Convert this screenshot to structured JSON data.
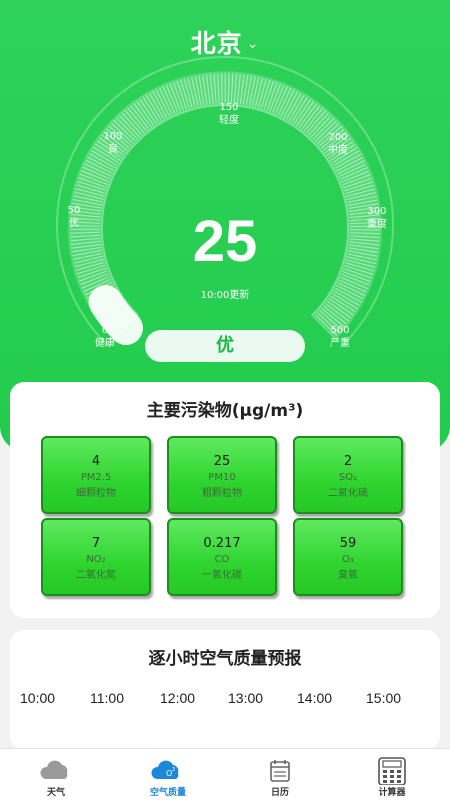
{
  "header": {
    "city": "北京",
    "city_dropdown_icon": "chevron-down-icon"
  },
  "gauge": {
    "value": "25",
    "update_time": "10:00更新",
    "level": "优",
    "ticks": [
      {
        "value": "0",
        "label": "健康"
      },
      {
        "value": "50",
        "label": "优"
      },
      {
        "value": "100",
        "label": "良"
      },
      {
        "value": "150",
        "label": "轻度"
      },
      {
        "value": "200",
        "label": "中度"
      },
      {
        "value": "300",
        "label": "重度"
      },
      {
        "value": "500",
        "label": "严重"
      }
    ],
    "fill_fraction": 0.05
  },
  "pollutants": {
    "title": "主要污染物(μg/m³)",
    "items": [
      {
        "value": "4",
        "name": "PM2.5",
        "desc": "细颗粒物"
      },
      {
        "value": "25",
        "name": "PM10",
        "desc": "粗颗粒物"
      },
      {
        "value": "2",
        "name": "SO₂",
        "desc": "二氧化硫"
      },
      {
        "value": "7",
        "name": "NO₂",
        "desc": "二氧化氮"
      },
      {
        "value": "0.217",
        "name": "CO",
        "desc": "一氧化碳"
      },
      {
        "value": "59",
        "name": "O₃",
        "desc": "臭氧"
      }
    ]
  },
  "forecast": {
    "title": "逐小时空气质量预报",
    "hours": [
      "10:00",
      "11:00",
      "12:00",
      "13:00",
      "14:00",
      "15:00"
    ]
  },
  "nav": {
    "items": [
      {
        "label": "天气",
        "icon": "cloud-icon"
      },
      {
        "label": "空气质量",
        "icon": "air-quality-icon"
      },
      {
        "label": "日历",
        "icon": "calendar-icon"
      },
      {
        "label": "计算器",
        "icon": "calculator-icon"
      }
    ],
    "active_index": 1
  },
  "colors": {
    "primary_green": "#22cc4c",
    "active_blue": "#1e88d8"
  }
}
